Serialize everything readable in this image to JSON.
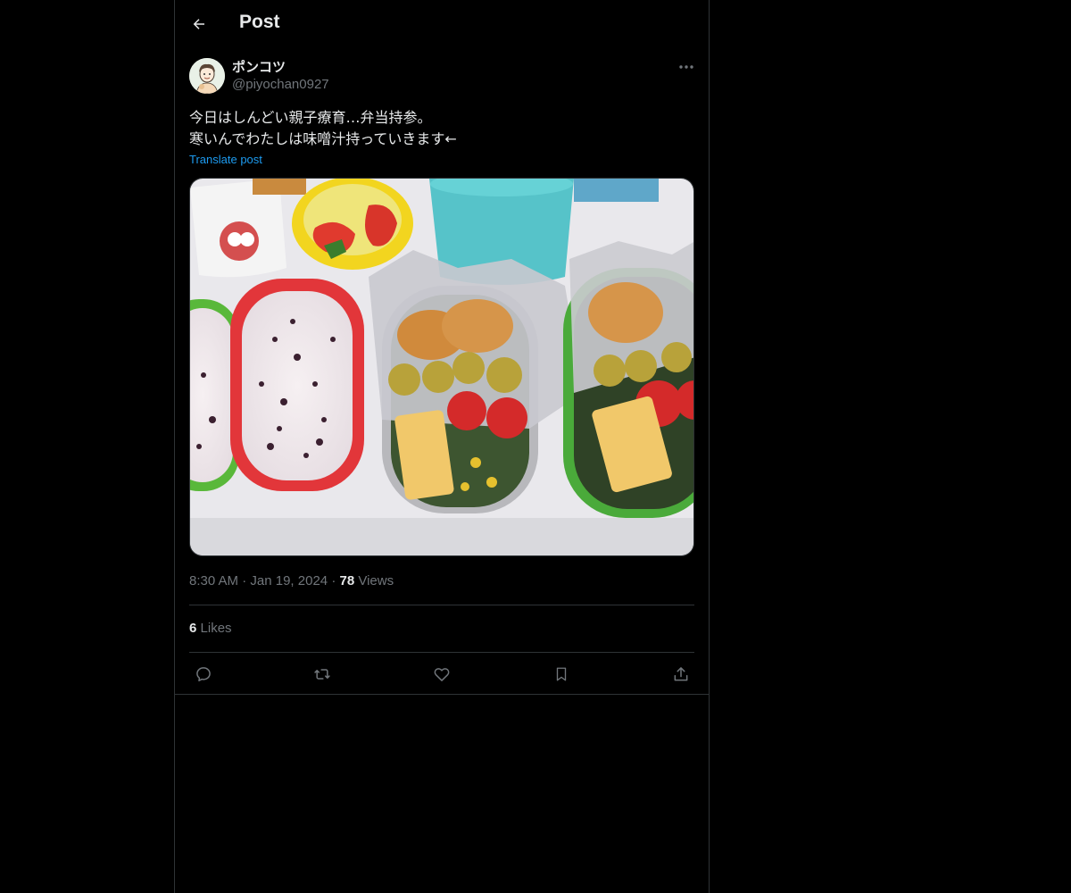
{
  "header": {
    "title": "Post",
    "back_icon": "arrow-left-icon"
  },
  "post": {
    "author": {
      "display_name": "ポンコツ",
      "handle": "@piyochan0927",
      "avatar_icon": "avatar-illustration"
    },
    "text_lines": [
      "今日はしんどい親子療育…弁当持参。",
      "寒いんでわたしは味噌汁持っていきます←"
    ],
    "translate_label": "Translate post",
    "media": {
      "description_icon": "bento-lunch-photo"
    },
    "time": "8:30 AM",
    "separator": "·",
    "date": "Jan 19, 2024",
    "views_count": "78",
    "views_label": "Views",
    "likes_count": "6",
    "likes_label": "Likes",
    "actions": [
      "reply-icon",
      "repost-icon",
      "like-icon",
      "bookmark-icon",
      "share-icon"
    ]
  },
  "colors": {
    "background": "#000000",
    "text": "#e7e9ea",
    "muted": "#71767b",
    "link": "#1d9bf0",
    "border": "#2f3336"
  }
}
